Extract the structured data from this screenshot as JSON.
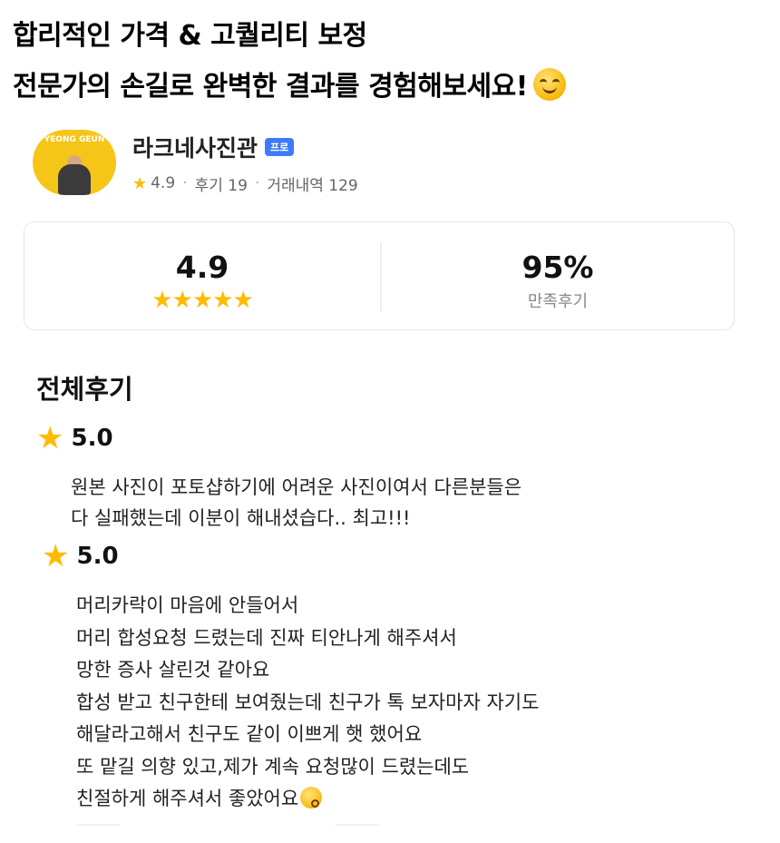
{
  "headline": {
    "line1": "합리적인 가격 & 고퀄리티 보정",
    "line2": "전문가의 손길로 완벽한 결과를 경험해보세요!",
    "emoji": "smiling-face"
  },
  "profile": {
    "avatar_text": "YEONG GEUN",
    "name": "라크네사진관",
    "badge": "프로",
    "rating": "4.9",
    "reviews": "후기 19",
    "transactions": "거래내역 129"
  },
  "stats": {
    "rating_value": "4.9",
    "stars": "★★★★★",
    "satisfaction_value": "95%",
    "satisfaction_label": "만족후기"
  },
  "section": {
    "title": "전체후기"
  },
  "reviews": [
    {
      "score": "5.0",
      "lines": [
        "원본 사진이 포토샵하기에 어려운 사진이여서 다른분들은",
        "다 실패했는데 이분이 해내셨습다.. 최고!!!"
      ]
    },
    {
      "score": "5.0",
      "lines": [
        "머리카락이 마음에 안들어서",
        "머리 합성요청 드렸는데 진짜 티안나게 해주셔서",
        "망한 증사 살린것 같아요",
        "합성 받고 친구한테 보여줬는데 친구가 톡 보자마자 자기도",
        "해달라고해서 친구도 같이 이쁘게 햇 했어요",
        "또 맡길 의향 있고,제가 계속 요청많이 드렸는데도",
        "친절하게 해주셔서 좋았어요"
      ],
      "trailing_emoji": "kissing-face"
    }
  ],
  "colors": {
    "star": "#ffbb00",
    "badge": "#3d7bf7",
    "avatar_bg": "#f5c518"
  }
}
